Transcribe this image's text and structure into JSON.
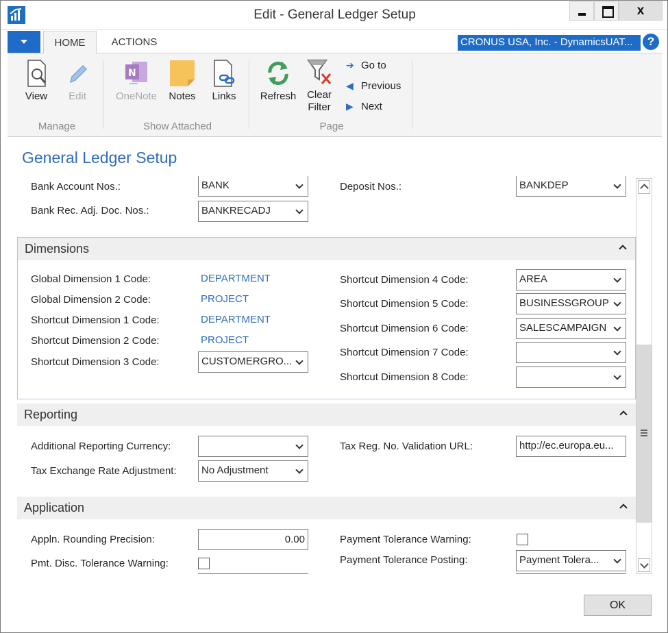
{
  "window": {
    "title": "Edit - General Ledger Setup",
    "close_label": "x"
  },
  "tabs": {
    "home": "HOME",
    "actions": "ACTIONS"
  },
  "company": "CRONUS USA, Inc. - DynamicsUAT...",
  "help": "?",
  "ribbon": {
    "manage": {
      "label": "Manage",
      "view": "View",
      "edit": "Edit"
    },
    "show_attached": {
      "label": "Show Attached",
      "onenote": "OneNote",
      "notes": "Notes",
      "links": "Links"
    },
    "page": {
      "label": "Page",
      "refresh": "Refresh",
      "clear_filter_1": "Clear",
      "clear_filter_2": "Filter",
      "go_to": "Go to",
      "previous": "Previous",
      "next": "Next"
    }
  },
  "page_title": "General Ledger Setup",
  "numbering": {
    "bank_account_nos": {
      "label": "Bank Account Nos.:",
      "value": "BANK"
    },
    "bank_rec_adj": {
      "label": "Bank Rec. Adj. Doc. Nos.:",
      "value": "BANKRECADJ"
    },
    "deposit_nos": {
      "label": "Deposit Nos.:",
      "value": "BANKDEP"
    }
  },
  "dimensions": {
    "title": "Dimensions",
    "global1": {
      "label": "Global Dimension 1 Code:",
      "value": "DEPARTMENT"
    },
    "global2": {
      "label": "Global Dimension 2 Code:",
      "value": "PROJECT"
    },
    "shortcut1": {
      "label": "Shortcut Dimension 1 Code:",
      "value": "DEPARTMENT"
    },
    "shortcut2": {
      "label": "Shortcut Dimension 2 Code:",
      "value": "PROJECT"
    },
    "shortcut3": {
      "label": "Shortcut Dimension 3 Code:",
      "value": "CUSTOMERGRO..."
    },
    "shortcut4": {
      "label": "Shortcut Dimension 4 Code:",
      "value": "AREA"
    },
    "shortcut5": {
      "label": "Shortcut Dimension 5 Code:",
      "value": "BUSINESSGROUP"
    },
    "shortcut6": {
      "label": "Shortcut Dimension 6 Code:",
      "value": "SALESCAMPAIGN"
    },
    "shortcut7": {
      "label": "Shortcut Dimension 7 Code:",
      "value": ""
    },
    "shortcut8": {
      "label": "Shortcut Dimension 8 Code:",
      "value": ""
    }
  },
  "reporting": {
    "title": "Reporting",
    "add_currency": {
      "label": "Additional Reporting Currency:",
      "value": ""
    },
    "tax_exch": {
      "label": "Tax Exchange Rate Adjustment:",
      "value": "No Adjustment"
    },
    "tax_reg_url": {
      "label": "Tax Reg. No. Validation URL:",
      "value": "http://ec.europa.eu..."
    }
  },
  "application": {
    "title": "Application",
    "rounding": {
      "label": "Appln. Rounding Precision:",
      "value": "0.00"
    },
    "pmt_disc_warning": {
      "label": "Pmt. Disc. Tolerance Warning:",
      "checked": false
    },
    "pay_tol_warning": {
      "label": "Payment Tolerance Warning:",
      "checked": false
    },
    "pay_tol_posting": {
      "label": "Payment Tolerance Posting:",
      "value": "Payment Tolera..."
    }
  },
  "ok_label": "OK",
  "colors": {
    "accent": "#1e6cc8",
    "link": "#2e6cc0",
    "section_bg": "#efefef"
  }
}
